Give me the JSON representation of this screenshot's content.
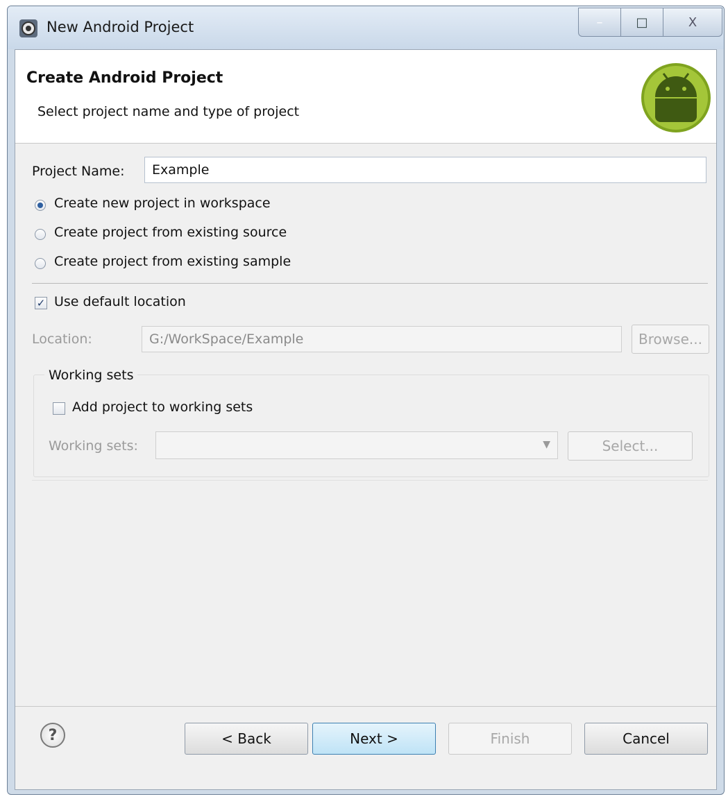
{
  "window": {
    "title": "New Android Project",
    "min_glyph": "–",
    "max_glyph": "□",
    "close_glyph": "X"
  },
  "header": {
    "title": "Create Android Project",
    "subtitle": "Select project name and type of project"
  },
  "form": {
    "project_name_label": "Project Name:",
    "project_name_value": "Example",
    "radio_options": [
      {
        "label": "Create new project in workspace",
        "selected": true
      },
      {
        "label": "Create project from existing source",
        "selected": false
      },
      {
        "label": "Create project from existing sample",
        "selected": false
      }
    ],
    "use_default_location_label": "Use default location",
    "use_default_location_checked": true,
    "location_label": "Location:",
    "location_value": "G:/WorkSpace/Example",
    "browse_label": "Browse...",
    "working_sets_group_label": "Working sets",
    "add_to_working_sets_label": "Add project to working sets",
    "add_to_working_sets_checked": false,
    "working_sets_label": "Working sets:",
    "working_sets_value": "",
    "select_label": "Select..."
  },
  "footer": {
    "help_glyph": "?",
    "back_label": "< Back",
    "next_label": "Next >",
    "finish_label": "Finish",
    "cancel_label": "Cancel"
  },
  "colors": {
    "window_frame": "#cfdbe8",
    "dialog_bg": "#f0f0f0",
    "android_green": "#a4c639",
    "default_button_border": "#3c7fb1"
  }
}
